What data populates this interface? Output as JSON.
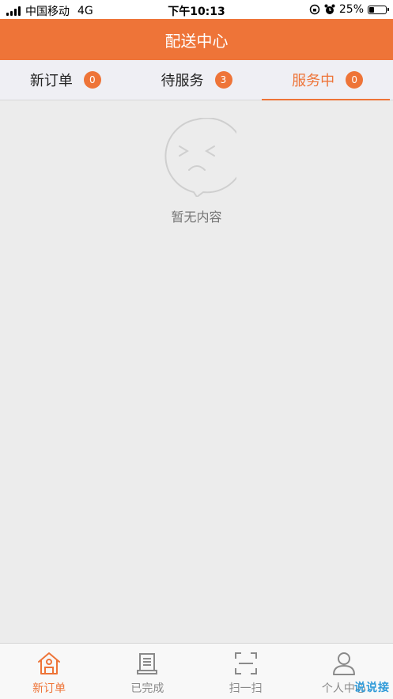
{
  "status_bar": {
    "carrier": "中国移动",
    "network": "4G",
    "time": "下午10:13",
    "battery": "25%",
    "battery_level": 0.25
  },
  "header": {
    "title": "配送中心"
  },
  "tabs": [
    {
      "label": "新订单",
      "count": "0",
      "active": false
    },
    {
      "label": "待服务",
      "count": "3",
      "active": false
    },
    {
      "label": "服务中",
      "count": "0",
      "active": true
    }
  ],
  "empty_state": {
    "text": "暂无内容",
    "icon": "sad-face-icon"
  },
  "bottom_nav": [
    {
      "label": "新订单",
      "icon": "home-icon",
      "active": true
    },
    {
      "label": "已完成",
      "icon": "document-icon",
      "active": false
    },
    {
      "label": "扫一扫",
      "icon": "scan-icon",
      "active": false
    },
    {
      "label": "个人中心",
      "icon": "user-icon",
      "active": false
    }
  ],
  "watermark": "说说接",
  "colors": {
    "accent": "#ee7438",
    "background": "#ececec",
    "inactive": "#8a8a8a"
  }
}
